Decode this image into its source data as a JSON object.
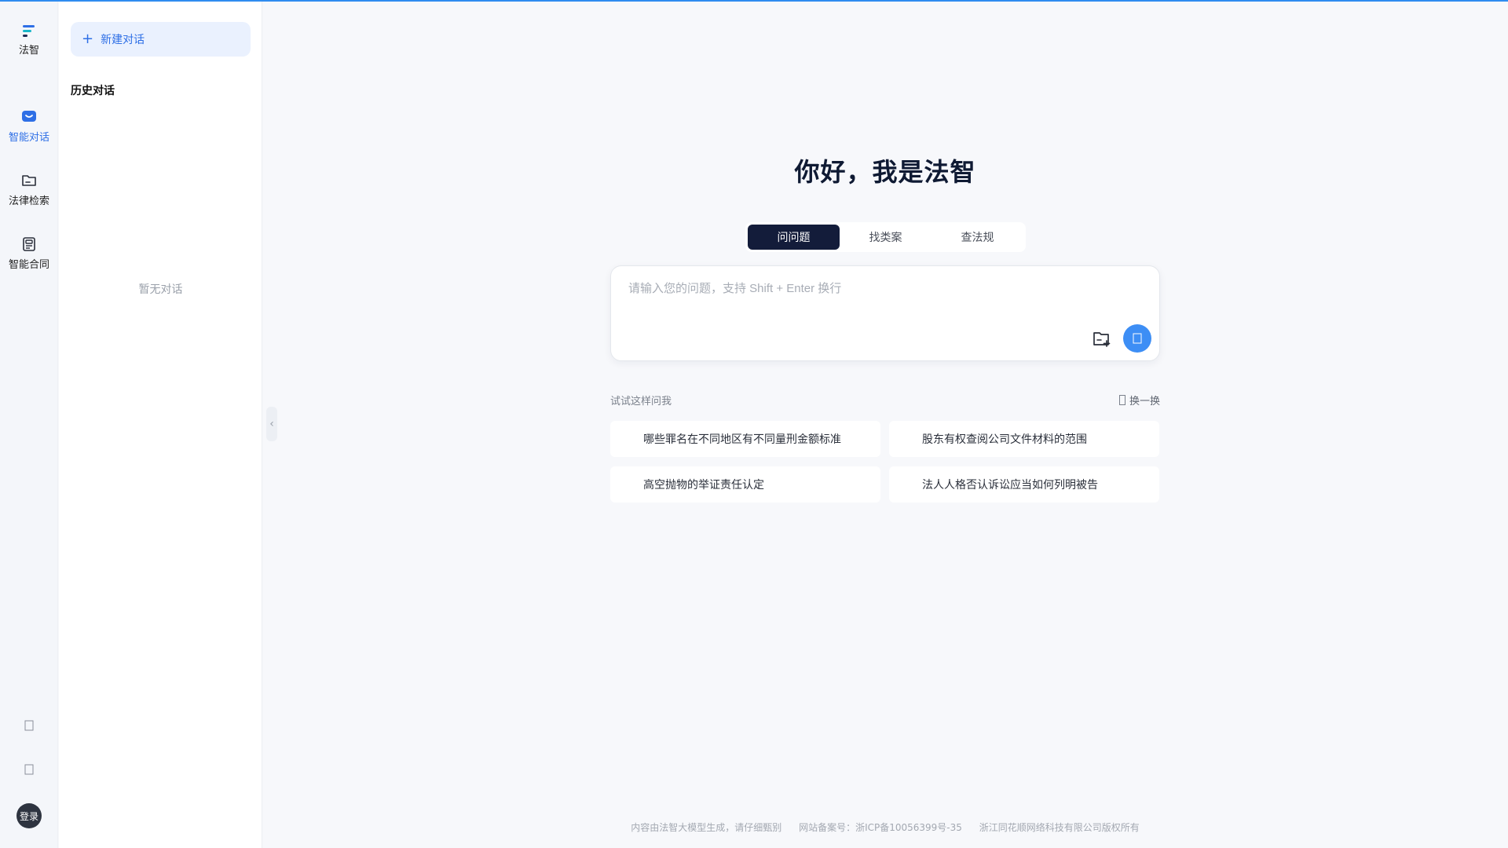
{
  "app": {
    "logo_text": "法智"
  },
  "rail": {
    "items": [
      {
        "label": "智能对话",
        "icon": "chat-icon",
        "active": true
      },
      {
        "label": "法律检索",
        "icon": "folder-icon",
        "active": false
      },
      {
        "label": "智能合同",
        "icon": "contract-icon",
        "active": false
      }
    ],
    "bottom_icons": [
      "settings-icon",
      "help-icon"
    ],
    "avatar_label": "登录"
  },
  "history": {
    "new_chat_label": "新建对话",
    "title": "历史对话",
    "empty_text": "暂无对话"
  },
  "main": {
    "greeting": "你好，我是法智",
    "tabs": [
      {
        "label": "问问题",
        "active": true
      },
      {
        "label": "找类案",
        "active": false
      },
      {
        "label": "查法规",
        "active": false
      }
    ],
    "input": {
      "placeholder": "请输入您的问题，支持 Shift + Enter 换行",
      "value": ""
    },
    "suggest": {
      "label": "试试这样问我",
      "refresh_label": "换一换",
      "items": [
        "哪些罪名在不同地区有不同量刑金额标准",
        "股东有权查阅公司文件材料的范围",
        "高空抛物的举证责任认定",
        "法人人格否认诉讼应当如何列明被告"
      ]
    }
  },
  "footer": {
    "disclaimer": "内容由法智大模型生成，请仔细甄别",
    "icp": "网站备案号：浙ICP备10056399号-35",
    "copyright": "浙江同花顺网络科技有限公司版权所有"
  },
  "colors": {
    "accent": "#2e6fe6",
    "active_tab_bg": "#131c3a",
    "send_button": "#3d8ef5",
    "top_line": "#2f8cf0"
  }
}
